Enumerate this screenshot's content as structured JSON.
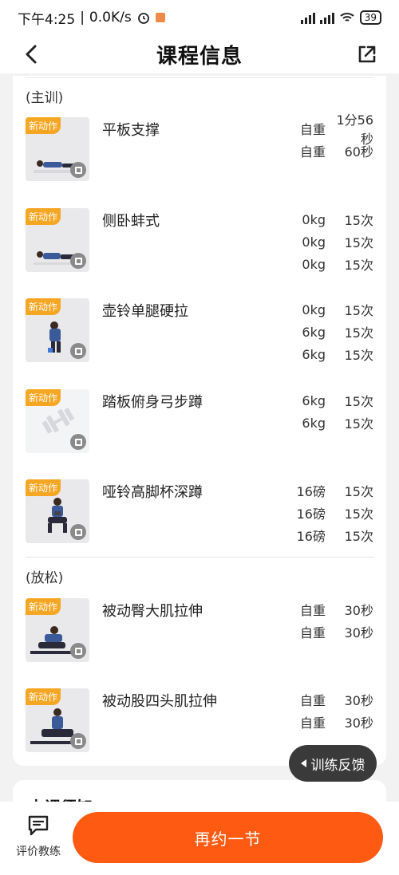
{
  "status_bar": {
    "time": "下午4:25",
    "speed": "0.0K/s",
    "battery": "39"
  },
  "header": {
    "title": "课程信息"
  },
  "sections": [
    {
      "label": "(主训)"
    },
    {
      "label": "(放松)"
    }
  ],
  "exercises": [
    {
      "tag": "新动作",
      "name": "平板支撑",
      "sets": [
        {
          "w": "自重",
          "r": "1分56秒"
        },
        {
          "w": "自重",
          "r": "60秒"
        }
      ]
    },
    {
      "tag": "新动作",
      "name": "侧卧蚌式",
      "sets": [
        {
          "w": "0kg",
          "r": "15次"
        },
        {
          "w": "0kg",
          "r": "15次"
        },
        {
          "w": "0kg",
          "r": "15次"
        }
      ]
    },
    {
      "tag": "新动作",
      "name": "壶铃单腿硬拉",
      "sets": [
        {
          "w": "0kg",
          "r": "15次"
        },
        {
          "w": "6kg",
          "r": "15次"
        },
        {
          "w": "6kg",
          "r": "15次"
        }
      ]
    },
    {
      "tag": "新动作",
      "name": "踏板俯身弓步蹲",
      "sets": [
        {
          "w": "6kg",
          "r": "15次"
        },
        {
          "w": "6kg",
          "r": "15次"
        }
      ]
    },
    {
      "tag": "新动作",
      "name": "哑铃高脚杯深蹲",
      "sets": [
        {
          "w": "16磅",
          "r": "15次"
        },
        {
          "w": "16磅",
          "r": "15次"
        },
        {
          "w": "16磅",
          "r": "15次"
        }
      ]
    },
    {
      "tag": "新动作",
      "name": "被动臀大肌拉伸",
      "sets": [
        {
          "w": "自重",
          "r": "30秒"
        },
        {
          "w": "自重",
          "r": "30秒"
        }
      ]
    },
    {
      "tag": "新动作",
      "name": "被动股四头肌拉伸",
      "sets": [
        {
          "w": "自重",
          "r": "30秒"
        },
        {
          "w": "自重",
          "r": "30秒"
        }
      ]
    }
  ],
  "feedback_label": "训练反馈",
  "next_section_title": "上课须知",
  "bottom": {
    "coach_label": "评价教练",
    "book_label": "再约一节"
  },
  "colors": {
    "accent": "#ff5a12",
    "tag": "#f5a623"
  }
}
